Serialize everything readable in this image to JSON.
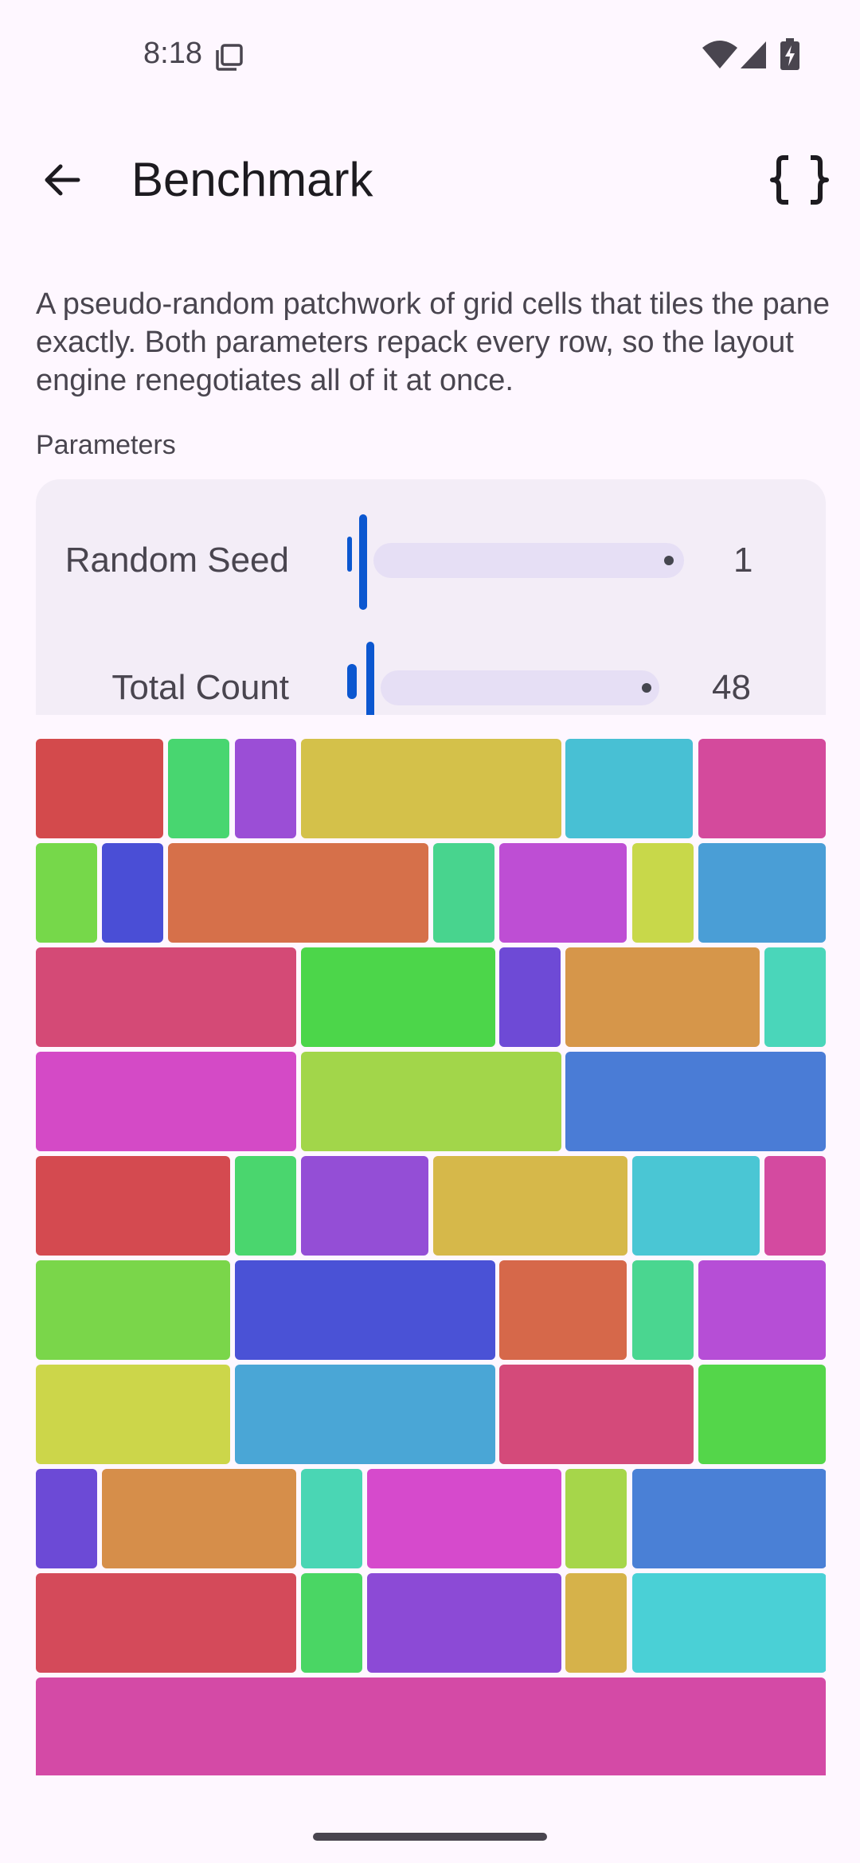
{
  "status_bar": {
    "time": "8:18"
  },
  "app_bar": {
    "title": "Benchmark"
  },
  "description": "A pseudo-random patchwork of grid cells that tiles the pane exactly. Both parameters repack every row, so the layout engine renegotiates all of it at once.",
  "parameters": {
    "section_label": "Parameters",
    "random_seed": {
      "label": "Random Seed",
      "value": "1"
    },
    "total_count": {
      "label": "Total Count",
      "value": "48"
    }
  },
  "grid": {
    "rows": [
      [
        {
          "span": 2,
          "color": "#D34A4C"
        },
        {
          "span": 1,
          "color": "#48D670"
        },
        {
          "span": 1,
          "color": "#9B4ED6"
        },
        {
          "span": 4,
          "color": "#D4C14A"
        },
        {
          "span": 2,
          "color": "#48C0D4"
        },
        {
          "span": 2,
          "color": "#D44A9C"
        }
      ],
      [
        {
          "span": 1,
          "color": "#76D84A"
        },
        {
          "span": 1,
          "color": "#4A4ED6"
        },
        {
          "span": 4,
          "color": "#D6704A"
        },
        {
          "span": 1,
          "color": "#48D48E"
        },
        {
          "span": 2,
          "color": "#BE4ED4"
        },
        {
          "span": 1,
          "color": "#C8D84A"
        },
        {
          "span": 2,
          "color": "#4A9ED6"
        }
      ],
      [
        {
          "span": 4,
          "color": "#D44A76"
        },
        {
          "span": 3,
          "color": "#4CD64A"
        },
        {
          "span": 1,
          "color": "#6E4AD6"
        },
        {
          "span": 3,
          "color": "#D6964A"
        },
        {
          "span": 1,
          "color": "#4AD6BA"
        }
      ],
      [
        {
          "span": 4,
          "color": "#D44AC6"
        },
        {
          "span": 4,
          "color": "#A2D64A"
        },
        {
          "span": 4,
          "color": "#4A7CD6"
        }
      ],
      [
        {
          "span": 3,
          "color": "#D44A50"
        },
        {
          "span": 1,
          "color": "#4AD66E"
        },
        {
          "span": 2,
          "color": "#944ED6"
        },
        {
          "span": 3,
          "color": "#D6B84A"
        },
        {
          "span": 2,
          "color": "#4AC6D4"
        },
        {
          "span": 1,
          "color": "#D44AA0"
        }
      ],
      [
        {
          "span": 3,
          "color": "#7AD64A"
        },
        {
          "span": 4,
          "color": "#4A52D6"
        },
        {
          "span": 2,
          "color": "#D6684A"
        },
        {
          "span": 1,
          "color": "#4AD690"
        },
        {
          "span": 2,
          "color": "#B64ED6"
        }
      ],
      [
        {
          "span": 3,
          "color": "#CCD64A"
        },
        {
          "span": 4,
          "color": "#4AA6D6"
        },
        {
          "span": 3,
          "color": "#D44A7A"
        },
        {
          "span": 2,
          "color": "#54D64A"
        }
      ],
      [
        {
          "span": 1,
          "color": "#6C4AD6"
        },
        {
          "span": 3,
          "color": "#D68E4A"
        },
        {
          "span": 1,
          "color": "#4AD6B4"
        },
        {
          "span": 3,
          "color": "#D64ACC"
        },
        {
          "span": 1,
          "color": "#A6D64A"
        },
        {
          "span": 3,
          "color": "#4A80D6"
        }
      ],
      [
        {
          "span": 4,
          "color": "#D44A5A"
        },
        {
          "span": 1,
          "color": "#4AD664"
        },
        {
          "span": 3,
          "color": "#8C4AD6"
        },
        {
          "span": 1,
          "color": "#D6B24A"
        },
        {
          "span": 3,
          "color": "#4AD0D6"
        }
      ],
      [
        {
          "span": 12,
          "color": "#D44AA6"
        }
      ]
    ]
  }
}
